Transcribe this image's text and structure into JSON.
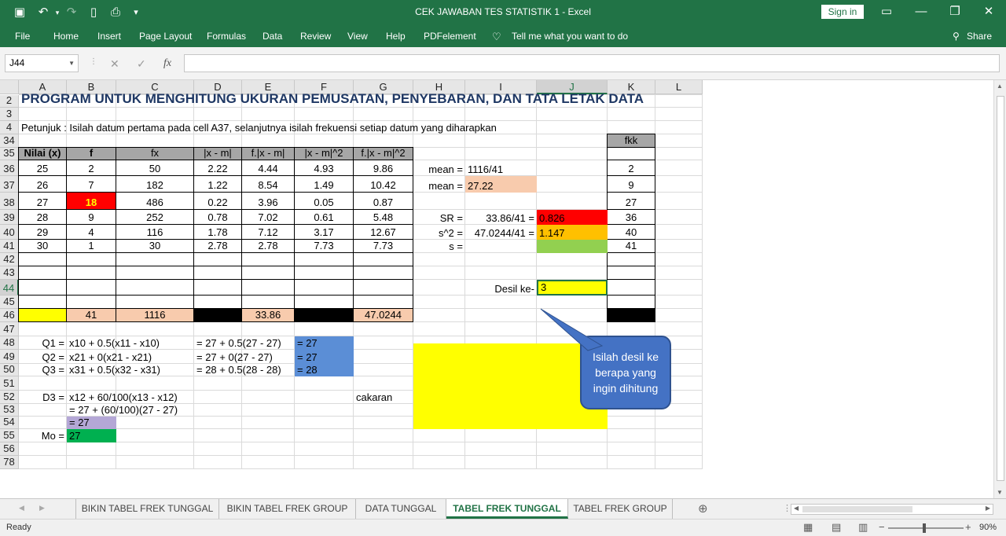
{
  "window": {
    "title": "CEK JAWABAN TES STATISTIK 1  -  Excel",
    "sign_in": "Sign in",
    "share": "Share",
    "menus": [
      "File",
      "Home",
      "Insert",
      "Page Layout",
      "Formulas",
      "Data",
      "Review",
      "View",
      "Help",
      "PDFelement"
    ],
    "tell_me": "Tell me what you want to do"
  },
  "formula_bar": {
    "name_box": "J44",
    "fx": "fx",
    "value": ""
  },
  "columns": [
    "A",
    "B",
    "C",
    "D",
    "E",
    "F",
    "G",
    "H",
    "I",
    "J",
    "K",
    "L"
  ],
  "selected_cell": {
    "col": "J",
    "row": "44"
  },
  "rows": [
    "2",
    "3",
    "4",
    "34",
    "35",
    "36",
    "37",
    "38",
    "39",
    "40",
    "41",
    "42",
    "43",
    "44",
    "45",
    "46",
    "47",
    "48",
    "49",
    "50",
    "51",
    "52",
    "53",
    "54",
    "55",
    "56",
    "78"
  ],
  "cells": {
    "title": "PROGRAM UNTUK MENGHITUNG UKURAN PEMUSATAN, PENYEBARAN, DAN TATA LETAK DATA",
    "instruction": "Petunjuk : Isilah datum pertama pada cell A37, selanjutnya isilah frekuensi setiap datum yang diharapkan",
    "fkk_header": "fkk",
    "headers": [
      "Nilai (x)",
      "f",
      "fx",
      "|x - m|",
      "f.|x - m|",
      "|x - m|^2",
      "f.|x - m|^2"
    ],
    "table": [
      [
        "25",
        "2",
        "50",
        "2.22",
        "4.44",
        "4.93",
        "9.86"
      ],
      [
        "26",
        "7",
        "182",
        "1.22",
        "8.54",
        "1.49",
        "10.42"
      ],
      [
        "27",
        "18",
        "486",
        "0.22",
        "3.96",
        "0.05",
        "0.87"
      ],
      [
        "28",
        "9",
        "252",
        "0.78",
        "7.02",
        "0.61",
        "5.48"
      ],
      [
        "29",
        "4",
        "116",
        "1.78",
        "7.12",
        "3.17",
        "12.67"
      ],
      [
        "30",
        "1",
        "30",
        "2.78",
        "2.78",
        "7.73",
        "7.73"
      ]
    ],
    "fkk": [
      "2",
      "9",
      "27",
      "36",
      "40",
      "41"
    ],
    "totals": {
      "f": "41",
      "fx": "1116",
      "fxm": "33.86",
      "fxm2": "47.0244"
    },
    "mean_label": "mean =",
    "mean_formula": "1116/41",
    "mean_value": "27.22",
    "sr_label": "SR =",
    "sr_formula": "33.86/41 =",
    "sr_value": "0.826",
    "s2_label": "s^2 =",
    "s2_formula": "47.0244/41 =",
    "s2_value": "1.147",
    "s_label": "s =",
    "desil_label": "Desil ke-",
    "desil_value": "3",
    "q1_label": "Q1 =",
    "q1_formula": "x10 + 0.5(x11 - x10)",
    "q1_sub": "= 27 + 0.5(27 - 27)",
    "q1_result": "= 27",
    "q2_label": "Q2 =",
    "q2_formula": "x21 + 0(x21 - x21)",
    "q2_sub": "= 27 + 0(27 - 27)",
    "q2_result": "= 27",
    "q3_label": "Q3 =",
    "q3_formula": "x31 + 0.5(x32 - x31)",
    "q3_sub": "= 28 + 0.5(28 - 28)",
    "q3_result": "= 28",
    "d3_label": "D3 =",
    "d3_formula": "x12 + 60/100(x13 - x12)",
    "d3_sub": "= 27 + (60/100)(27 - 27)",
    "d3_result": "= 27",
    "cakaran": "cakaran",
    "mo_label": "Mo =",
    "mo_value": "27"
  },
  "callout": "Isilah desil ke\nberapa yang\ningin dihitung",
  "sheet_tabs": [
    "BIKIN TABEL FREK TUNGGAL",
    "BIKIN TABEL FREK GROUP",
    "DATA TUNGGAL",
    "TABEL FREK TUNGGAL",
    "TABEL FREK GROUP"
  ],
  "active_tab": "TABEL FREK TUNGGAL",
  "status": {
    "ready": "Ready",
    "zoom": "90%"
  },
  "colors": {
    "excel_green": "#217346",
    "peach": "#f8cbad",
    "red": "#ff0000",
    "orange": "#ffc000",
    "green": "#92d050",
    "yellow": "#ffff00",
    "blue": "#5b8ed6",
    "purple": "#b4a7d6",
    "green_dark": "#00b050",
    "callout": "#4472c4"
  }
}
